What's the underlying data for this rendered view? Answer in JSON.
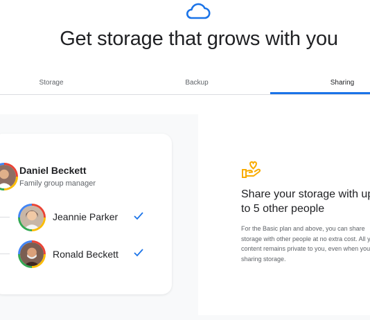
{
  "header": {
    "icon": "cloud-icon",
    "title": "Get storage that grows with you"
  },
  "tabs": [
    {
      "label": "Storage",
      "active": false
    },
    {
      "label": "Backup",
      "active": false
    },
    {
      "label": "Sharing",
      "active": true
    }
  ],
  "family": {
    "manager": {
      "name": "Daniel Beckett",
      "role": "Family group manager"
    },
    "members": [
      {
        "name": "Jeannie Parker",
        "status": "check-icon"
      },
      {
        "name": "Ronald Beckett",
        "status": "check-icon"
      }
    ]
  },
  "sharing": {
    "icon": "hand-heart-icon",
    "title": "Share your storage with up to 5 other people",
    "body": "For the Basic plan and above, you can share storage with other people at no extra cost. All your content remains private to you, even when you're sharing storage."
  },
  "colors": {
    "accent": "#1a73e8",
    "icon_yellow": "#f9ab00",
    "check": "#1a73e8",
    "title": "#202124",
    "muted": "#5f6368"
  }
}
